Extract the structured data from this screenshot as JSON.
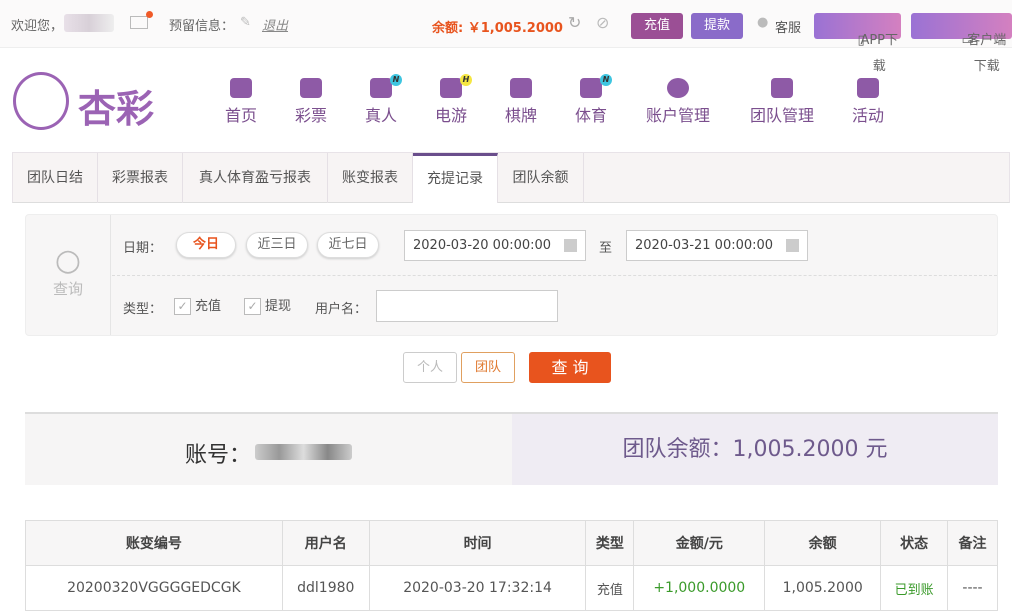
{
  "topbar": {
    "welcome": "欢迎您，",
    "reserved": "预留信息：",
    "logout": "退出",
    "balance": "余额: ￥1,005.2000",
    "recharge": "充值",
    "withdraw": "提款",
    "service": "客服",
    "app": "APP下载",
    "client": "客户端下载"
  },
  "logo": "杏彩",
  "nav": [
    {
      "label": "首页"
    },
    {
      "label": "彩票"
    },
    {
      "label": "真人",
      "badge": "N"
    },
    {
      "label": "电游",
      "badge": "H"
    },
    {
      "label": "棋牌"
    },
    {
      "label": "体育",
      "badge": "N"
    },
    {
      "label": "账户管理"
    },
    {
      "label": "团队管理"
    },
    {
      "label": "活动"
    }
  ],
  "tabs": [
    "团队日结",
    "彩票报表",
    "真人体育盈亏报表",
    "账变报表",
    "充提记录",
    "团队余额"
  ],
  "search": {
    "label": "查询",
    "date_label": "日期：",
    "today": "今日",
    "three": "近三日",
    "seven": "近七日",
    "start": "2020-03-20 00:00:00",
    "to": "至",
    "end": "2020-03-21 00:00:00",
    "type_label": "类型：",
    "recharge": "充值",
    "withdraw": "提现",
    "user_label": "用户名：",
    "user_value": ""
  },
  "buttons": {
    "personal": "个人",
    "team": "团队",
    "query": "查 询"
  },
  "summary": {
    "account": "账号：",
    "team_balance": "团队余额：1,005.2000 元"
  },
  "table": {
    "headers": [
      "账变编号",
      "用户名",
      "时间",
      "类型",
      "金额/元",
      "余额",
      "状态",
      "备注"
    ],
    "rows": [
      [
        "20200320VGGGGEDCGK",
        "ddl1980",
        "2020-03-20 17:32:14",
        "充值",
        "+1,000.0000",
        "1,005.2000",
        "已到账",
        "----"
      ]
    ]
  }
}
